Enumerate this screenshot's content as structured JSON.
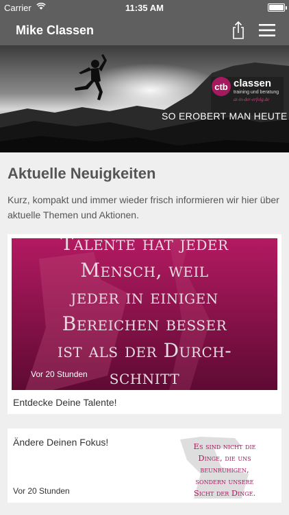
{
  "status_bar": {
    "carrier": "Carrier",
    "time": "11:35 AM",
    "battery_level": 1.0
  },
  "navbar": {
    "title": "Mike Classen",
    "share_icon": "share-icon",
    "menu_icon": "hamburger-menu-icon"
  },
  "hero": {
    "logo_name": "classen",
    "logo_sub": "training und beratung",
    "logo_url": "at-in-der-erfolg.de",
    "tagline": "SO EROBERT MAN HEUTE"
  },
  "news": {
    "title": "Aktuelle Neuigkeiten",
    "description": "Kurz, kompakt und immer wieder frisch informieren wir hier über aktuelle Themen und Aktionen."
  },
  "posts": [
    {
      "caption": "Entdecke Deine Talente!",
      "time": "Vor 20 Stunden",
      "quote_lines": [
        "Talente hat jeder",
        "Mensch, weil",
        "jeder in einigen",
        "Bereichen besser",
        "ist als der Durch-",
        "schnitt"
      ]
    },
    {
      "caption": "Ändere Deinen Fokus!",
      "time": "Vor 20 Stunden",
      "quote_lines": [
        "Es sind nicht die",
        "Dinge, die uns",
        "beunruhigen,",
        "sondern unsere",
        "Sicht der Dinge."
      ]
    }
  ],
  "colors": {
    "nav_bg": "#5f5f5f",
    "accent": "#a51a5f",
    "page_bg": "#efefef"
  }
}
